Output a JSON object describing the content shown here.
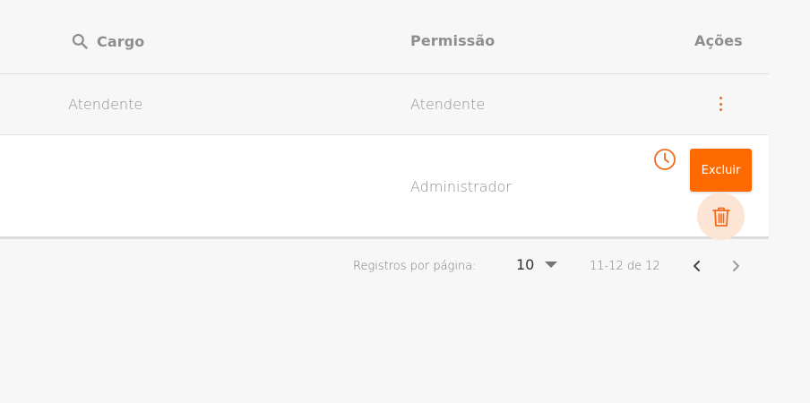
{
  "table": {
    "headers": {
      "cargo": "Cargo",
      "permissao": "Permissão",
      "acoes": "Ações"
    },
    "rows": [
      {
        "cargo": "Atendente",
        "permissao": "Atendente"
      },
      {
        "cargo": "",
        "permissao": "Administrador"
      }
    ],
    "actions": {
      "delete_label": "Excluir"
    }
  },
  "pagination": {
    "rows_per_page_label": "Registros por página:",
    "rows_per_page_value": "10",
    "range_text": "11-12 de 12"
  },
  "icons": {
    "search": "search-icon",
    "more": "more-vert-icon",
    "clock": "clock-icon",
    "trash": "trash-icon",
    "dropdown": "arrow-drop-down-icon",
    "prev": "chevron-left-icon",
    "next": "chevron-right-icon"
  },
  "colors": {
    "accent": "#ff6a00",
    "accent_light": "#fde5d6",
    "background": "#f7f7f7"
  }
}
